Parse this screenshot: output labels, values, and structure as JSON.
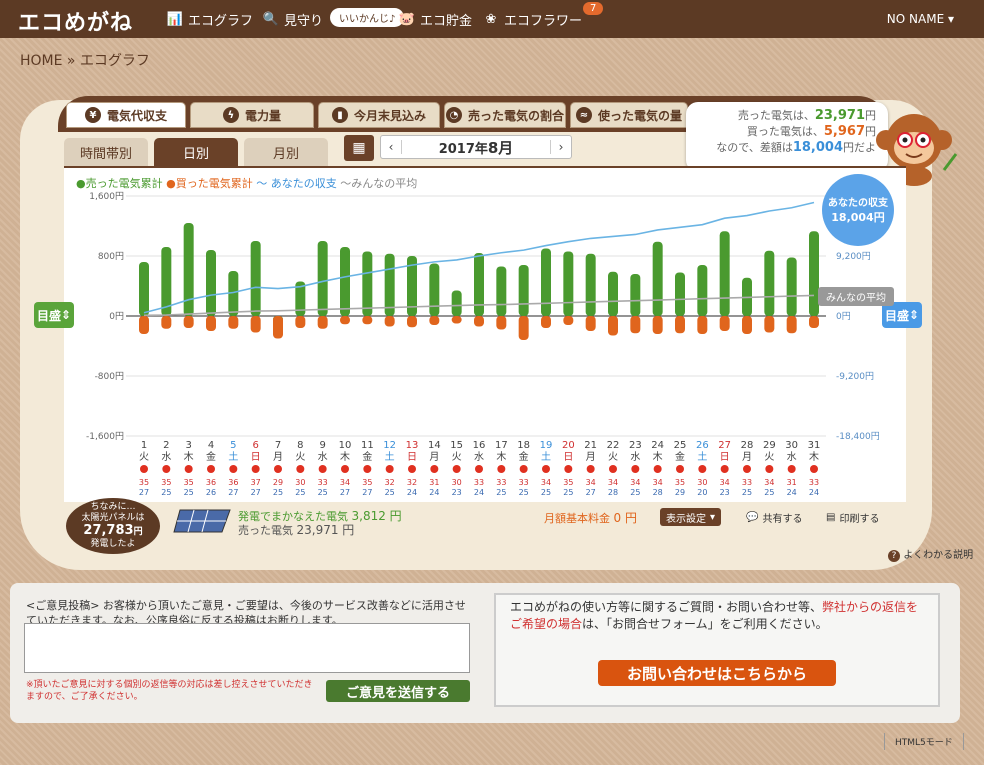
{
  "header": {
    "logo": "エコめがね",
    "nav": [
      {
        "label": "エコグラフ",
        "icon": "bar-chart-icon"
      },
      {
        "label": "見守り",
        "icon": "magnifier-icon"
      },
      {
        "label": "エコ貯金",
        "icon": "piggy-icon"
      },
      {
        "label": "エコフラワー",
        "icon": "flower-icon"
      }
    ],
    "pill": "いいかんじ♪",
    "badge": "7",
    "user": "NO NAME"
  },
  "breadcrumb": "HOME » エコグラフ",
  "tabs": [
    "電気代収支",
    "電力量",
    "今月末見込み",
    "売った電気の割合",
    "使った電気の量"
  ],
  "subtabs": [
    "時間帯別",
    "日別",
    "月別"
  ],
  "period": {
    "prefix": "2017年",
    "month": "8月"
  },
  "bubble": {
    "l1a": "売った電気は、",
    "l1v": "23,971",
    "l1u": "円",
    "l2a": "買った電気は、",
    "l2v": "5,967",
    "l2u": "円",
    "l3a": "なので、差額は",
    "l3v": "18,004",
    "l3u": "円だよ"
  },
  "legend": {
    "sold": "●売った電気累計",
    "bought": "●買った電気累計",
    "mine": "〜 あなたの収支",
    "avg": "〜みんなの平均"
  },
  "scale_button": "目盛",
  "your_balance": {
    "label": "あなたの収支",
    "value": "18,004円"
  },
  "avg_label": "みんなの平均",
  "panel": {
    "l1": "ちなみに…",
    "l2": "太陽光パネルは",
    "v": "27,783",
    "u": "円",
    "l3": "発電したよ"
  },
  "summary": {
    "l1": "発電でまかなえた電気",
    "v1": "3,812 円",
    "l2": "売った電気",
    "v2": "23,971 円",
    "basic": "月額基本料金",
    "basicv": "0 円"
  },
  "buttons": {
    "display": "表示設定",
    "share": "共有する",
    "print": "印刷する",
    "help": "よくわかる説明"
  },
  "feedback": {
    "text": "<ご意見投稿> お客様から頂いたご意見・ご要望は、今後のサービス改善などに活用させていただきます。なお、公序良俗に反する投稿はお断りします。",
    "note": "※頂いたご意見に対する個別の返信等の対応は差し控えさせていただきますので、ご了承ください。",
    "submit": "ご意見を送信する"
  },
  "contact": {
    "t1": "エコめがねの使い方等に関するご質問・お問い合わせ等、",
    "t1r": "弊社からの返信をご希望の場合",
    "t2": "は、「お問合せフォーム」をご利用ください。",
    "button": "お問い合わせはこちらから"
  },
  "html5": "HTML5モード",
  "colors": {
    "sold": "#4a9a2f",
    "bought": "#e0651d",
    "mine": "#6ab4e4",
    "avg": "#aaaaaa",
    "brand": "#5c3a24"
  },
  "chart_data": {
    "type": "bar",
    "ylim": [
      -1600,
      1600
    ],
    "yticks": [
      "1,600円",
      "800円",
      "0円",
      "-800円",
      "-1,600円"
    ],
    "y2ticks": [
      "9,200円",
      "0円",
      "-9,200円",
      "-18,400円"
    ],
    "days": [
      "1",
      "2",
      "3",
      "4",
      "5",
      "6",
      "7",
      "8",
      "9",
      "10",
      "11",
      "12",
      "13",
      "14",
      "15",
      "16",
      "17",
      "18",
      "19",
      "20",
      "21",
      "22",
      "23",
      "24",
      "25",
      "26",
      "27",
      "28",
      "29",
      "30",
      "31"
    ],
    "weekdays": [
      "火",
      "水",
      "木",
      "金",
      "土",
      "日",
      "月",
      "火",
      "水",
      "木",
      "金",
      "土",
      "日",
      "月",
      "火",
      "水",
      "木",
      "金",
      "土",
      "日",
      "月",
      "火",
      "水",
      "木",
      "金",
      "土",
      "日",
      "月",
      "火",
      "水",
      "木"
    ],
    "hi": [
      "35",
      "35",
      "35",
      "36",
      "36",
      "37",
      "29",
      "30",
      "33",
      "34",
      "35",
      "32",
      "32",
      "31",
      "30",
      "33",
      "33",
      "33",
      "34",
      "35",
      "34",
      "34",
      "34",
      "34",
      "35",
      "30",
      "34",
      "33",
      "34",
      "31",
      "33"
    ],
    "lo": [
      "27",
      "25",
      "25",
      "26",
      "27",
      "27",
      "25",
      "25",
      "25",
      "27",
      "27",
      "25",
      "24",
      "24",
      "23",
      "24",
      "25",
      "25",
      "25",
      "25",
      "27",
      "28",
      "25",
      "28",
      "29",
      "20",
      "23",
      "25",
      "25",
      "24",
      "24"
    ],
    "series": [
      {
        "name": "売った電気累計",
        "values": [
          720,
          920,
          1240,
          880,
          600,
          1000,
          -80,
          460,
          1000,
          920,
          860,
          830,
          800,
          700,
          340,
          840,
          660,
          680,
          900,
          860,
          830,
          590,
          560,
          990,
          580,
          680,
          1130,
          510,
          870,
          780,
          1130
        ]
      },
      {
        "name": "買った電気累計",
        "values": [
          -240,
          -170,
          -160,
          -200,
          -170,
          -220,
          -300,
          -160,
          -170,
          -110,
          -110,
          -140,
          -150,
          -120,
          -100,
          -140,
          -180,
          -320,
          -160,
          -120,
          -200,
          -260,
          -230,
          -240,
          -230,
          -240,
          -200,
          -240,
          -220,
          -230,
          -160
        ]
      },
      {
        "name": "あなたの収支",
        "values": [
          500,
          1400,
          2500,
          3200,
          3600,
          4400,
          4200,
          4500,
          5300,
          6000,
          6600,
          7200,
          7800,
          8300,
          8600,
          9200,
          9700,
          10100,
          10800,
          11400,
          11900,
          12200,
          12500,
          13200,
          13600,
          14000,
          15000,
          15400,
          16100,
          16600,
          17400
        ]
      },
      {
        "name": "みんなの平均",
        "values": [
          100,
          150,
          300,
          450,
          600,
          750,
          800,
          900,
          1000,
          1100,
          1200,
          1300,
          1400,
          1500,
          1600,
          1700,
          1750,
          1850,
          1950,
          2050,
          2150,
          2250,
          2350,
          2450,
          2550,
          2650,
          2750,
          2850,
          2950,
          3050,
          3150
        ]
      }
    ]
  }
}
